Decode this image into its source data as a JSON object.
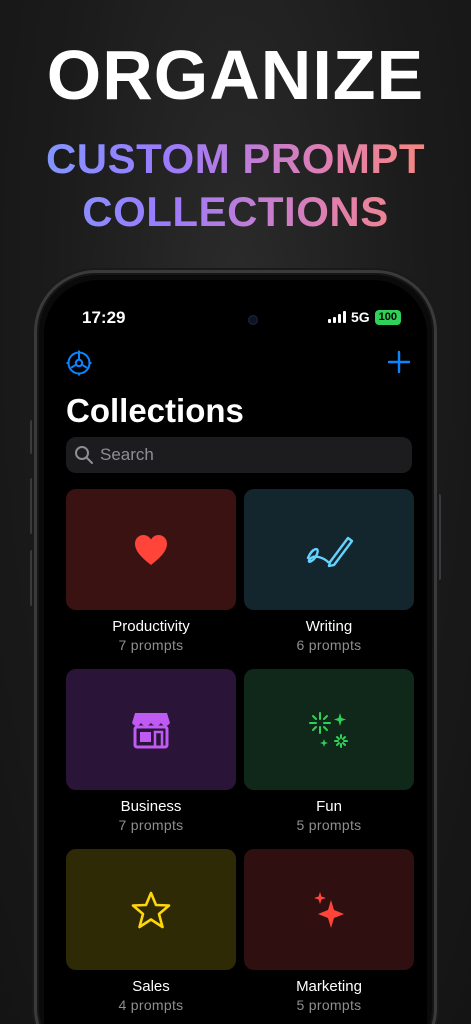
{
  "headline": "ORGANIZE",
  "subline1": "CUSTOM PROMPT",
  "subline2": "COLLECTIONS",
  "status": {
    "time": "17:29",
    "network": "5G",
    "battery": "100"
  },
  "nav": {
    "title": "Collections",
    "settings_icon": "gear-icon",
    "add_icon": "plus-icon"
  },
  "search": {
    "placeholder": "Search"
  },
  "colors": {
    "accent": "#0a84ff",
    "battery": "#30d158"
  },
  "collections": [
    {
      "name": "Productivity",
      "count": "7  prompts",
      "icon": "heart-icon",
      "tile_color": "#3a1212",
      "icon_color": "#ff453a"
    },
    {
      "name": "Writing",
      "count": "6  prompts",
      "icon": "pencil-scribble-icon",
      "tile_color": "#13262d",
      "icon_color": "#64d2ff"
    },
    {
      "name": "Business",
      "count": "7  prompts",
      "icon": "storefront-icon",
      "tile_color": "#2a1438",
      "icon_color": "#bf5af2"
    },
    {
      "name": "Fun",
      "count": "5  prompts",
      "icon": "fireworks-icon",
      "tile_color": "#10281a",
      "icon_color": "#30d158"
    },
    {
      "name": "Sales",
      "count": "4  prompts",
      "icon": "star-icon",
      "tile_color": "#2e2a06",
      "icon_color": "#ffd60a"
    },
    {
      "name": "Marketing",
      "count": "5  prompts",
      "icon": "sparkles-icon",
      "tile_color": "#2f0f0f",
      "icon_color": "#ff453a"
    }
  ]
}
